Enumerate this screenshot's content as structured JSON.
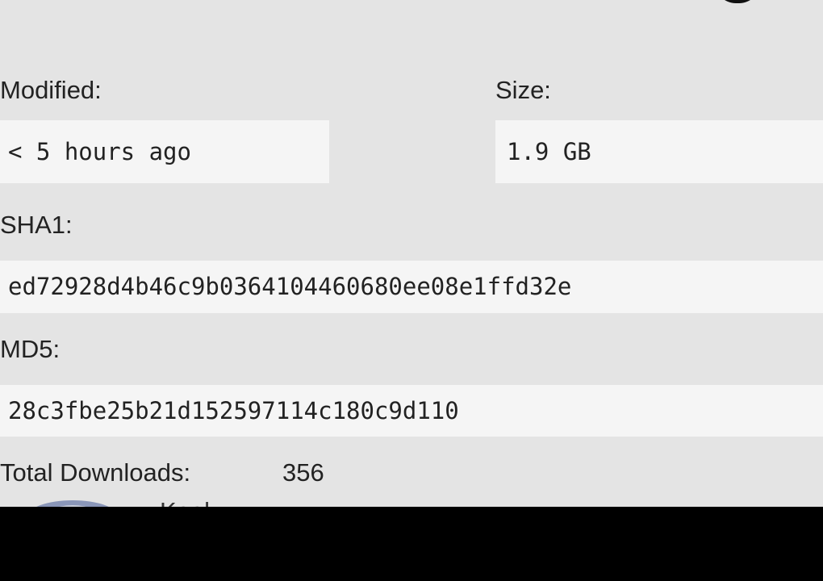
{
  "details": {
    "modified": {
      "label": "Modified:",
      "value": "< 5 hours ago"
    },
    "size": {
      "label": "Size:",
      "value": "1.9 GB"
    },
    "sha1": {
      "label": "SHA1:",
      "value": "ed72928d4b46c9b0364104460680ee08e1ffd32e"
    },
    "md5": {
      "label": "MD5:",
      "value": "28c3fbe25b21d152597114c180c9d110"
    },
    "downloads": {
      "label": "Total Downloads:",
      "value": "356"
    }
  },
  "author": {
    "name_partial": "Kaal"
  },
  "colors": {
    "panel_background": "#e4e4e4",
    "field_background": "#f5f5f5",
    "text": "#222222",
    "bottom_bar": "#000000"
  },
  "icons": {
    "top_right": "circle-icon",
    "author_avatar": "avatar-icon"
  }
}
